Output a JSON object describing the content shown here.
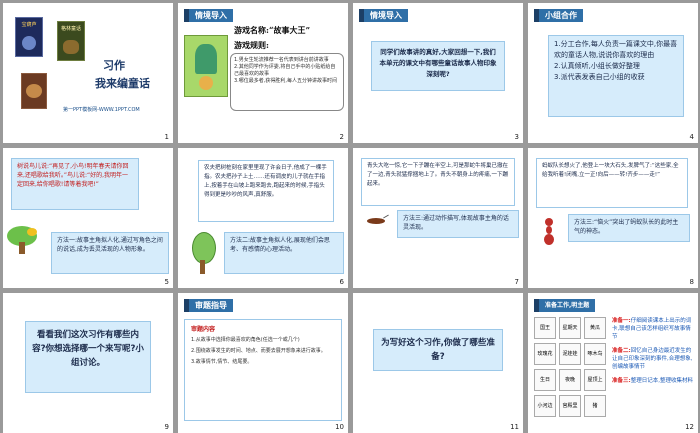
{
  "slides": [
    {
      "n": "1",
      "title1": "习作",
      "title2": "我来编童话",
      "footer": "第一PPT模板网-WWW.1PPT.COM",
      "book1": "宝葫芦",
      "book2": "格林童话"
    },
    {
      "n": "2",
      "header": "情境导入",
      "game_title": "游戏名称:“故事大王”",
      "rules_title": "游戏规则:",
      "rules": [
        "1.男女生轮流推荐一名代表到讲台前讲故事",
        "2.其他同学作为评委,将自己手中的小贴纸给自己最喜欢的故事",
        "3.哪位最多者,获得胜利,每人五分钟讲故事时间"
      ]
    },
    {
      "n": "3",
      "header": "情境导入",
      "text": "同学们故事讲的真好,大家回想一下,我们本单元的课文中有哪些童话故事人物印象深刻呢?"
    },
    {
      "n": "4",
      "header": "小组合作",
      "items": [
        "1.分工合作,每人负责一篇课文中,你最喜欢的童话人物,说说你喜欢的理由",
        "2.认真倾听,小组长做好整理",
        "3.派代表发表自己小组的收获"
      ]
    },
    {
      "n": "5",
      "dialogue": "树说鸟儿说:“再见了,小鸟!明年春天请你回来,还唱歌给我听。”鸟儿说:“好的,我明年一定回来,给你唱歌!请等着我吧!”",
      "method": "方法一:故事主角拟人化,通过写角色之间的说话,成为丢灵活现的人物形象。"
    },
    {
      "n": "6",
      "story": "农夫把树桩刻在家里里现了许会日子,他成了一棵手指。农夫把孙子上土……还有调皮的儿子就在手指上,按着手在山坡上跑来跑去,跑起来的时候,手指头得到更是吵吵的风声,真舒服。",
      "method": "方法二:故事主角拟人化,展现他们会思考、有感情的心理活动。"
    },
    {
      "n": "7",
      "story": "青头大吃一惊,它一下子蹦在半空上,可是那蛇牛将巢已撤在了一边,青头就猛撑捆地上了。青头不朝身上的疼痛,一下蹦起来。",
      "method": "方法三:通过动作描写,体现故事主角的话灵活现。"
    },
    {
      "n": "8",
      "story": "蚂蚁队长想火了,他登上一块大石头,发脾气了:“这些家,全给我听着!闭嘴,立一正!向后——转!齐步——走!”",
      "method": "方法三:“恼火”突出了蚂蚁队长的此时主气的神态。"
    },
    {
      "n": "9",
      "question": "看看我们这次习作有哪些内容?你想选择哪一个来写呢?小组讨论。"
    },
    {
      "n": "10",
      "header": "审题指导",
      "sub": "审题内容",
      "lines": [
        "1.从故事中选择你最喜欢的角色(任选一个或几个)",
        "2.围绕故事发生的时间、地点、而要去展开想象来进行故事。",
        "3.故事情节,情节、结尾要。"
      ]
    },
    {
      "n": "11",
      "question": "为写好这个习作,你做了哪些准备?"
    },
    {
      "n": "12",
      "header": "准备工作,明主题",
      "cards": [
        "国王",
        "星期天",
        "黄瓜",
        "玫瑰花",
        "泥娃娃",
        "啄木鸟",
        "生日",
        "夜晚",
        "屋顶上",
        "小河边",
        "宫殿里",
        "猪"
      ],
      "prep1_label": "准备一:",
      "prep1": "仔细阅读课本上出示的词卡,联想自己该怎样组织写故事情节",
      "prep2_label": "准备二:",
      "prep2": "回忆自己身边最近发生的让自己印象深刻的事件,合理想象,创编故事情节",
      "prep3_label": "准备三:",
      "prep3": "整理日记本,整理收集材料"
    }
  ]
}
